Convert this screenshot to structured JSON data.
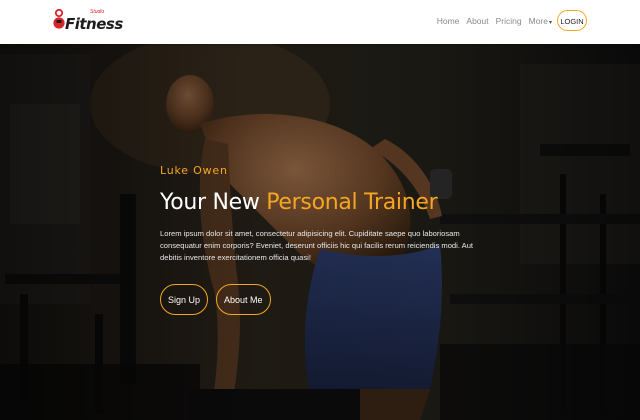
{
  "brand": {
    "name": "Fitness",
    "sub": "Studio",
    "accent_color": "#f5a623",
    "logo_red": "#d9262b"
  },
  "nav": {
    "items": [
      {
        "label": "Home"
      },
      {
        "label": "About"
      },
      {
        "label": "Pricing"
      },
      {
        "label": "More"
      }
    ],
    "login_label": "LOGIN"
  },
  "hero": {
    "name": "Luke Owen",
    "title_plain": "Your New ",
    "title_accent": "Personal Trainer",
    "description": "Lorem ipsum dolor sit amet, consectetur adipisicing elit. Cupiditate saepe quo laboriosam consequatur enim corporis? Eveniet, deserunt officiis hic qui facilis rerum reiciendis modi. Aut debitis inventore exercitationem officia quasi!",
    "buttons": [
      {
        "label": "Sign Up"
      },
      {
        "label": "About Me"
      }
    ]
  }
}
